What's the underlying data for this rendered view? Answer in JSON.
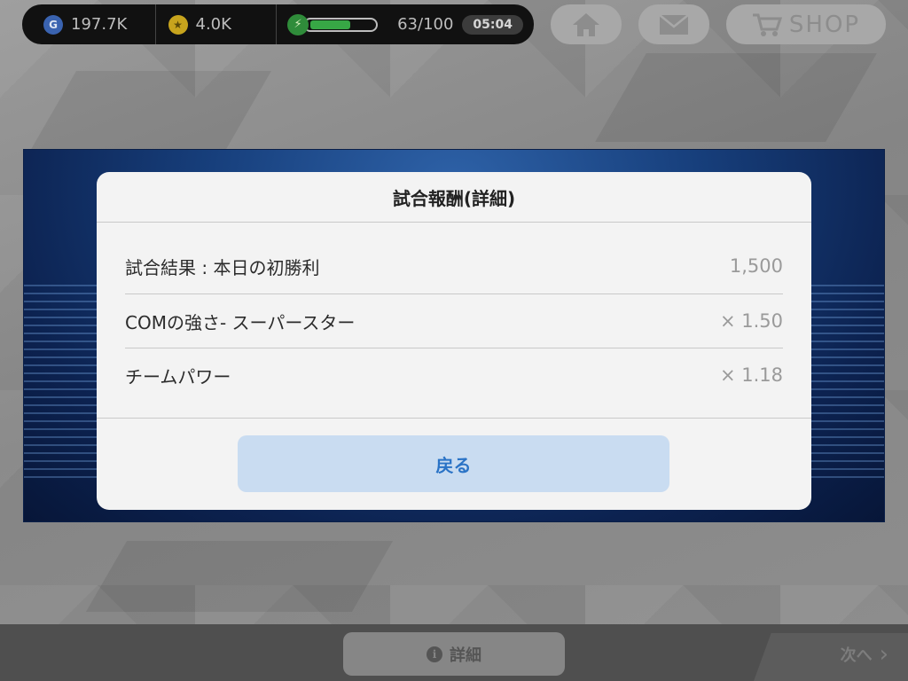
{
  "status": {
    "gp": "197.7K",
    "gp_icon_letter": "G",
    "coins": "4.0K",
    "energy_text": "63/100",
    "energy_fraction": 0.63,
    "timer": "05:04"
  },
  "top_buttons": {
    "shop_label": "SHOP"
  },
  "modal": {
    "title": "試合報酬(詳細)",
    "rows": [
      {
        "label": "試合結果 : 本日の初勝利",
        "value": "1,500"
      },
      {
        "label": "COMの強さ- スーパースター",
        "value": "× 1.50"
      },
      {
        "label": "チームパワー",
        "value": "× 1.18"
      }
    ],
    "back_label": "戻る"
  },
  "bottom": {
    "detail_label": "詳細",
    "info_glyph": "i",
    "next_label": "次へ",
    "next_glyph": "›"
  },
  "colors": {
    "energy_fill": "#37a745",
    "back_button_bg": "#c9dcf1",
    "back_button_text": "#2a73c6"
  }
}
